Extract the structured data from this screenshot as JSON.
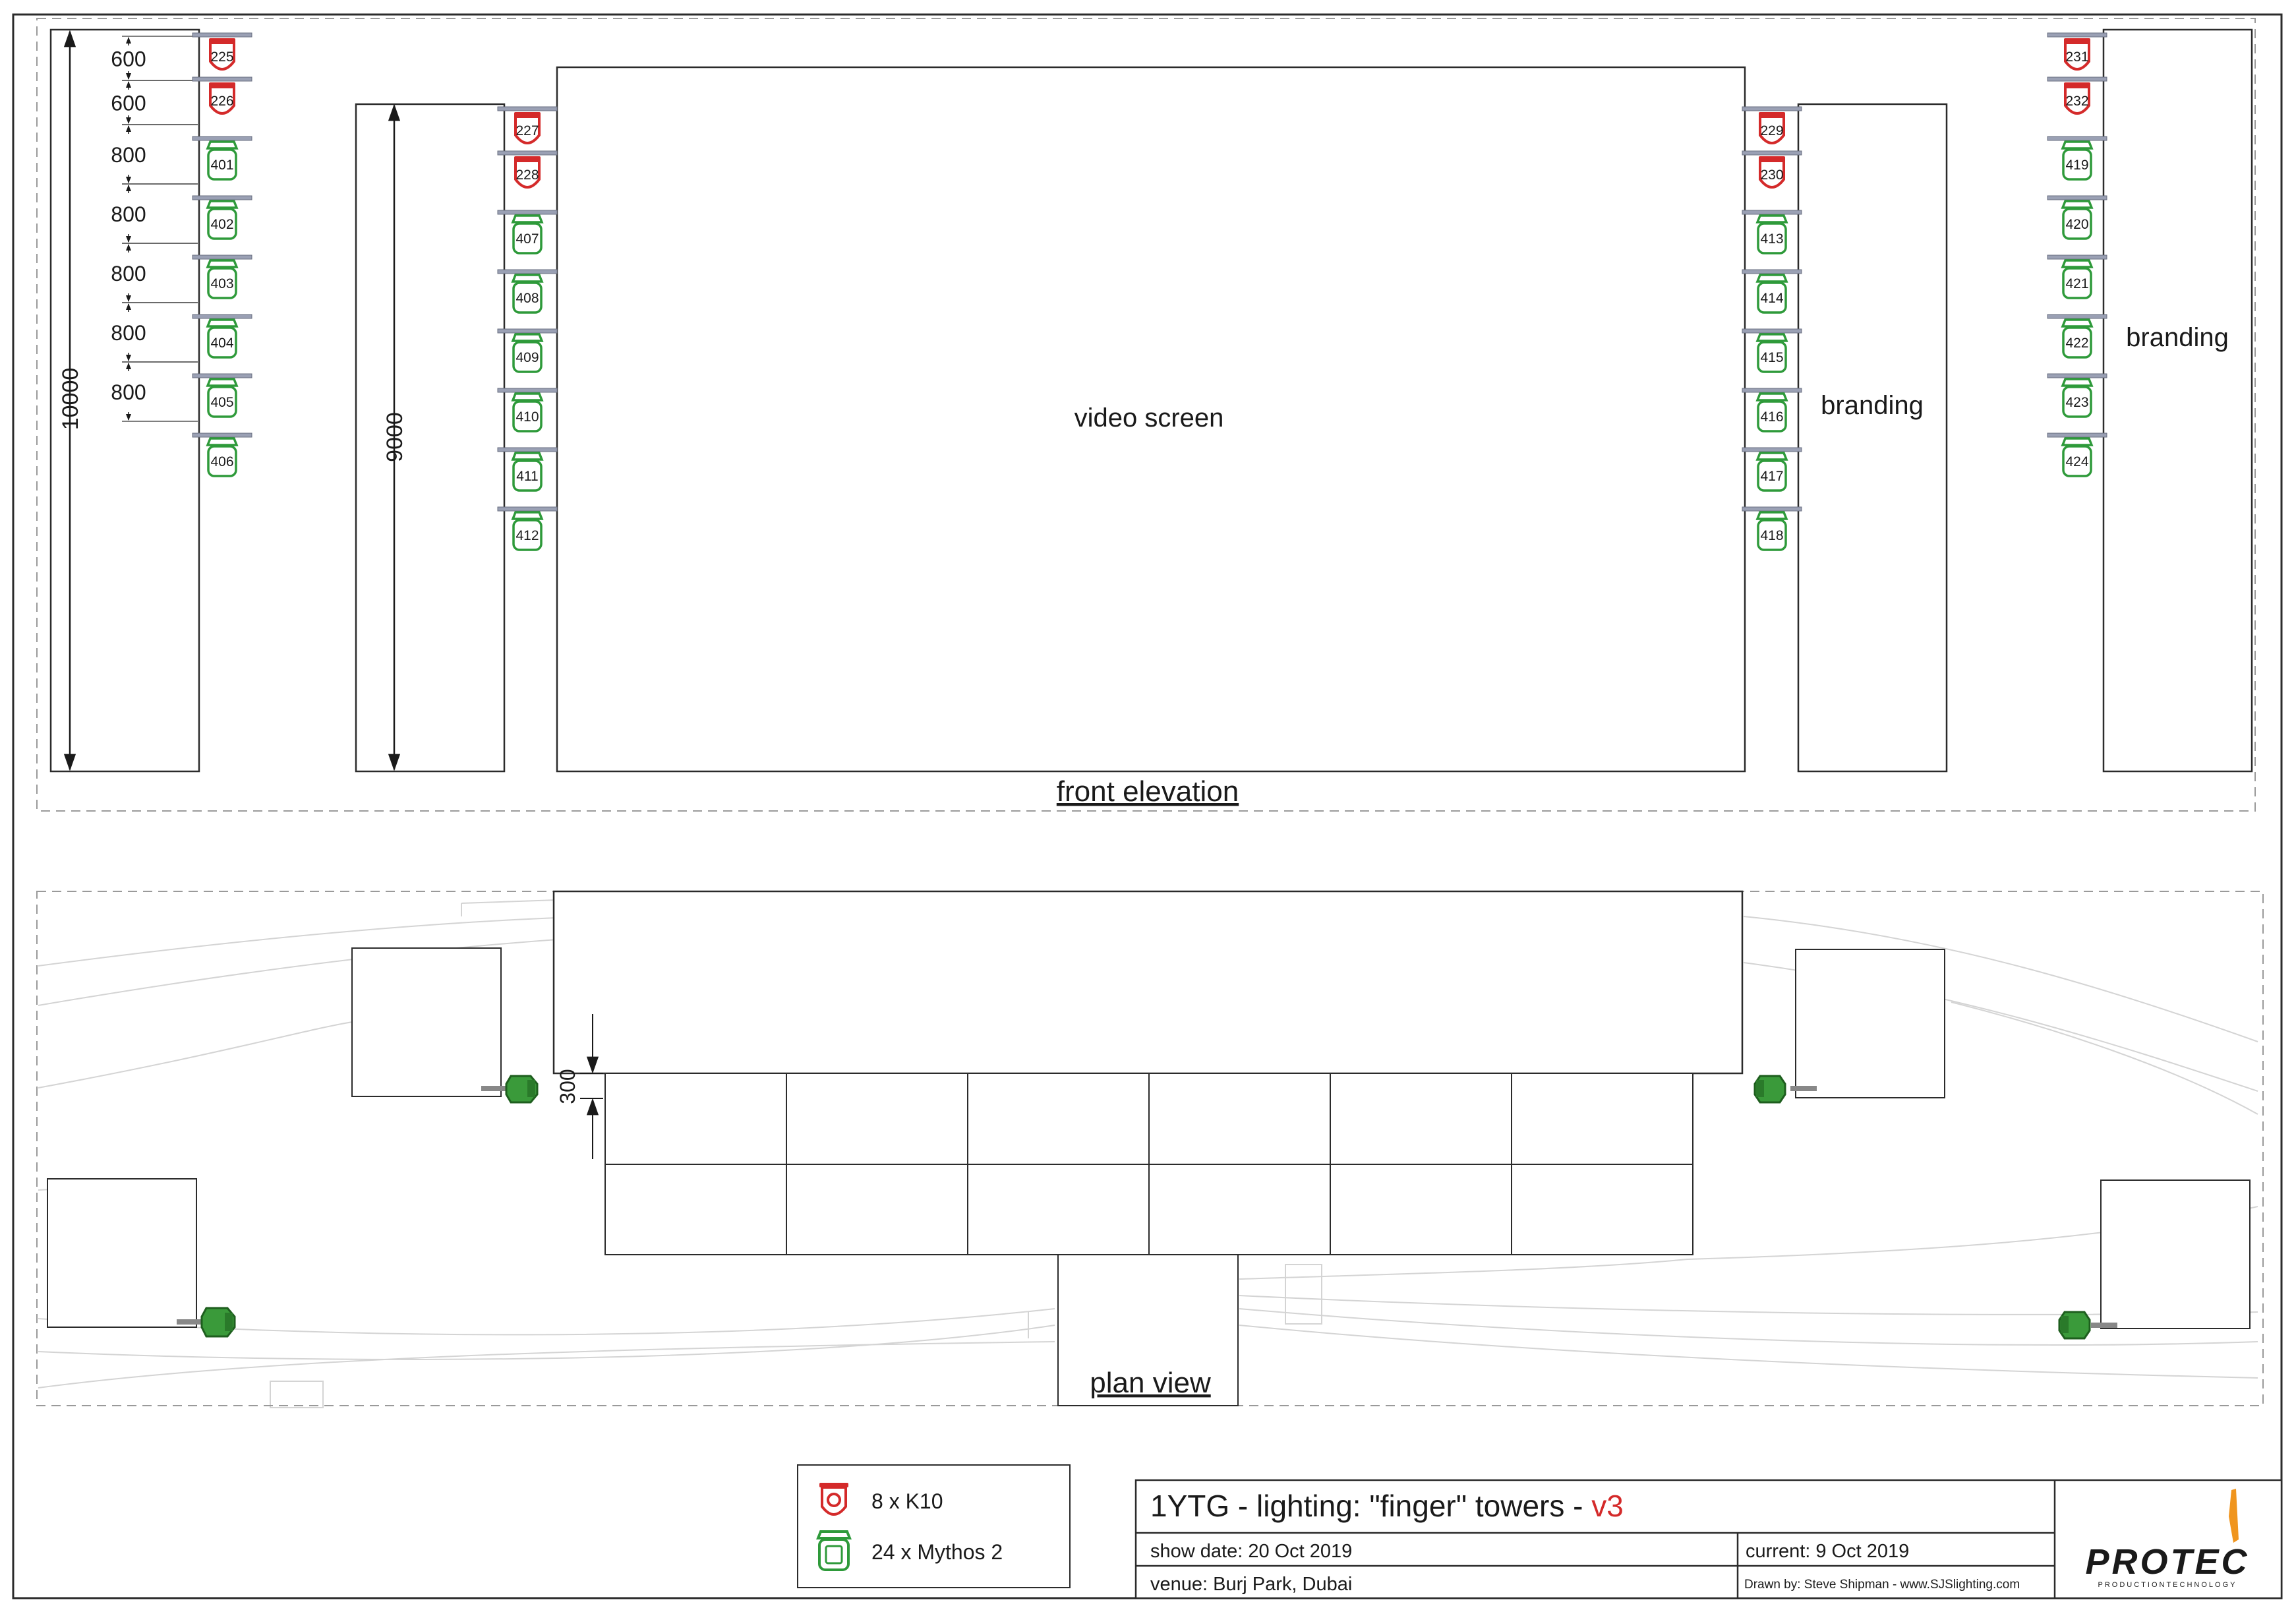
{
  "front": {
    "caption": "front elevation",
    "video_label": "video screen",
    "branding_mid": "branding",
    "branding_right": "branding",
    "tower_left_height": "10000",
    "tower_mid_height": "9000",
    "spacings": [
      "600",
      "600",
      "800",
      "800",
      "800",
      "800",
      "800"
    ],
    "columns": [
      {
        "fixtures": [
          {
            "type": "k10",
            "id": "225"
          },
          {
            "type": "k10",
            "id": "226"
          },
          {
            "type": "mythos",
            "id": "401"
          },
          {
            "type": "mythos",
            "id": "402"
          },
          {
            "type": "mythos",
            "id": "403"
          },
          {
            "type": "mythos",
            "id": "404"
          },
          {
            "type": "mythos",
            "id": "405"
          },
          {
            "type": "mythos",
            "id": "406"
          }
        ]
      },
      {
        "fixtures": [
          {
            "type": "k10",
            "id": "227"
          },
          {
            "type": "k10",
            "id": "228"
          },
          {
            "type": "mythos",
            "id": "407"
          },
          {
            "type": "mythos",
            "id": "408"
          },
          {
            "type": "mythos",
            "id": "409"
          },
          {
            "type": "mythos",
            "id": "410"
          },
          {
            "type": "mythos",
            "id": "411"
          },
          {
            "type": "mythos",
            "id": "412"
          }
        ]
      },
      {
        "fixtures": [
          {
            "type": "k10",
            "id": "229"
          },
          {
            "type": "k10",
            "id": "230"
          },
          {
            "type": "mythos",
            "id": "413"
          },
          {
            "type": "mythos",
            "id": "414"
          },
          {
            "type": "mythos",
            "id": "415"
          },
          {
            "type": "mythos",
            "id": "416"
          },
          {
            "type": "mythos",
            "id": "417"
          },
          {
            "type": "mythos",
            "id": "418"
          }
        ]
      },
      {
        "fixtures": [
          {
            "type": "k10",
            "id": "231"
          },
          {
            "type": "k10",
            "id": "232"
          },
          {
            "type": "mythos",
            "id": "419"
          },
          {
            "type": "mythos",
            "id": "420"
          },
          {
            "type": "mythos",
            "id": "421"
          },
          {
            "type": "mythos",
            "id": "422"
          },
          {
            "type": "mythos",
            "id": "423"
          },
          {
            "type": "mythos",
            "id": "424"
          }
        ]
      }
    ]
  },
  "plan": {
    "caption": "plan view",
    "offset_label": "300"
  },
  "legend": {
    "k10": "8 x K10",
    "mythos": "24 x Mythos 2"
  },
  "titleblock": {
    "title_main": "1YTG - lighting: \"finger\" towers - ",
    "title_version": "v3",
    "show_date": "show date:  20 Oct 2019",
    "current": "current: 9 Oct 2019",
    "venue": "venue: Burj Park, Dubai",
    "drawn_by": "Drawn by: Steve Shipman - www.SJSlighting.com",
    "logo": "PROTEC",
    "logo_sub": "PRODUCTIONTECHNOLOGY"
  },
  "colors": {
    "k10": "#d42a2a",
    "mythos": "#2e9a3a",
    "plan_fixture": "#3a9a3a",
    "version": "#d42a2a",
    "logo_accent": "#f0951e",
    "line": "#2b2b2b",
    "dashed": "#9a9a9a",
    "background_lines": "#d4d4d4"
  }
}
